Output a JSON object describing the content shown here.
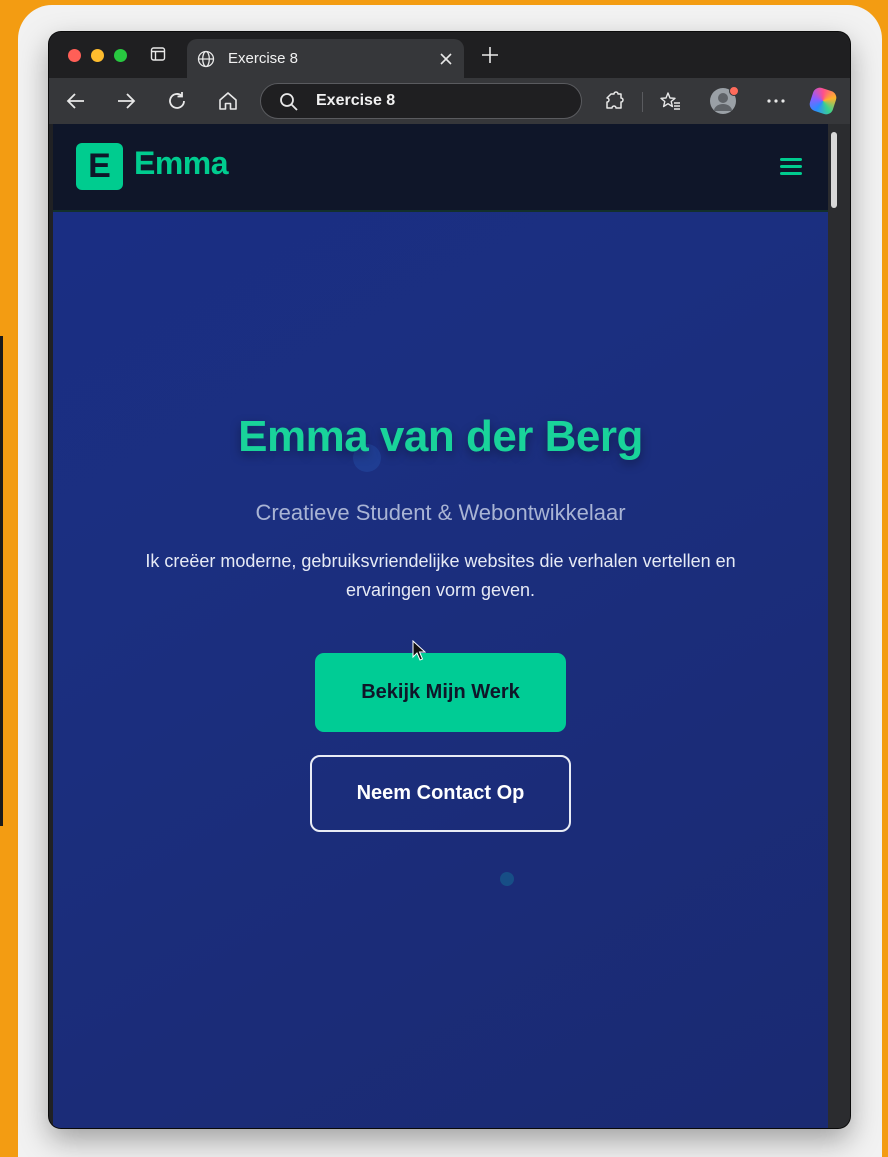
{
  "browser": {
    "tab_title": "Exercise 8",
    "address_text": "Exercise 8"
  },
  "site": {
    "logo_letter": "E",
    "logo_text": "Emma",
    "accent_color": "#00cc8f"
  },
  "hero": {
    "title": "Emma van der Berg",
    "subtitle": "Creatieve Student & Webontwikkelaar",
    "description": "Ik creëer moderne, gebruiksvriendelijke websites die verhalen vertellen en ervaringen vorm geven.",
    "primary_button": "Bekijk Mijn Werk",
    "secondary_button": "Neem Contact Op"
  },
  "icons": [
    "tabs-icon",
    "globe-icon",
    "close-icon",
    "plus-icon",
    "back-icon",
    "forward-icon",
    "reload-icon",
    "home-icon",
    "search-icon",
    "extensions-icon",
    "favorites-icon",
    "profile-icon",
    "more-icon",
    "copilot-icon",
    "hamburger-menu-icon",
    "cursor-icon"
  ]
}
